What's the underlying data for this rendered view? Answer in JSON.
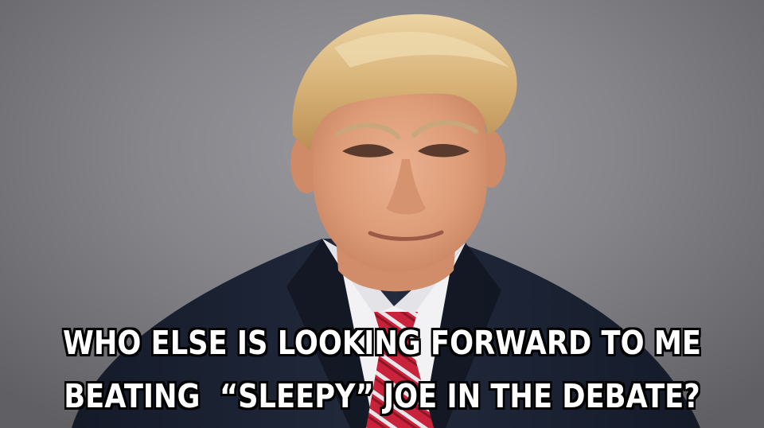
{
  "caption": {
    "line1": "WHO ELSE IS LOOKING FORWARD TO ME",
    "line2": "BEATING  “SLEEPY” JOE IN THE DEBATE?"
  },
  "colors": {
    "background": "#85858a",
    "suit": "#1c2233",
    "shirt": "#f2f2f4",
    "tie_red": "#c8233a",
    "hair": "#d9b57a",
    "skin": "#e3a37f",
    "text": "#ffffff",
    "text_outline": "#000000"
  }
}
